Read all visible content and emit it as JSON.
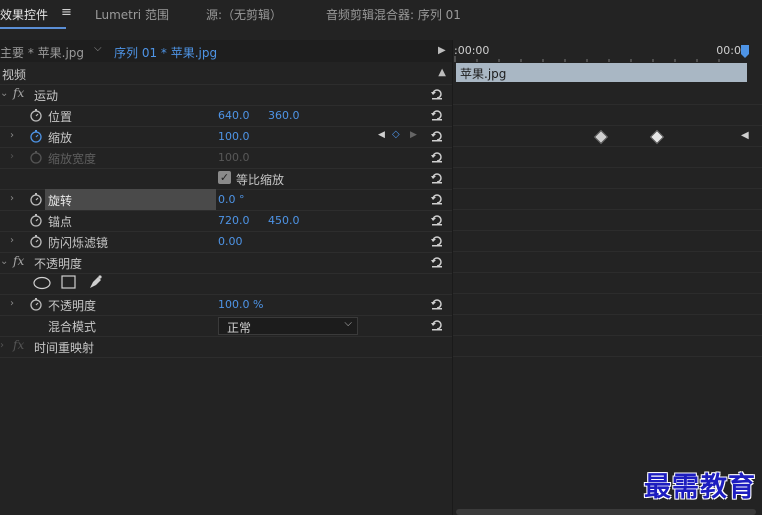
{
  "tabs": [
    {
      "label": "效果控件"
    },
    {
      "label": "Lumetri 范围"
    },
    {
      "label": "源:（无剪辑）"
    },
    {
      "label": "音频剪辑混合器: 序列 01"
    }
  ],
  "header": {
    "master_label": "主要 * 苹果.jpg",
    "sequence_label": "序列 01 * 苹果.jpg",
    "time_start": ":00:00",
    "time_end": "00:00"
  },
  "clip": {
    "name": "苹果.jpg"
  },
  "section_video": "视频",
  "effects": {
    "motion": {
      "label": "运动",
      "position": {
        "label": "位置",
        "x": "640.0",
        "y": "360.0"
      },
      "scale": {
        "label": "缩放",
        "value": "100.0"
      },
      "scale_width": {
        "label": "缩放宽度",
        "value": "100.0"
      },
      "uniform_scale": {
        "label": "等比缩放",
        "checked": true
      },
      "rotation": {
        "label": "旋转",
        "value": "0.0 °"
      },
      "anchor": {
        "label": "锚点",
        "x": "720.0",
        "y": "450.0"
      },
      "anti_flicker": {
        "label": "防闪烁滤镜",
        "value": "0.00"
      }
    },
    "opacity": {
      "label": "不透明度",
      "opacity": {
        "label": "不透明度",
        "value": "100.0 %"
      },
      "blend": {
        "label": "混合模式",
        "value": "正常"
      }
    },
    "time_remap": {
      "label": "时间重映射"
    }
  },
  "watermark": "最需教育",
  "colors": {
    "accent": "#4e94e6",
    "clip_bar": "#a9b7c4",
    "watermark": "#1d1dbf"
  }
}
